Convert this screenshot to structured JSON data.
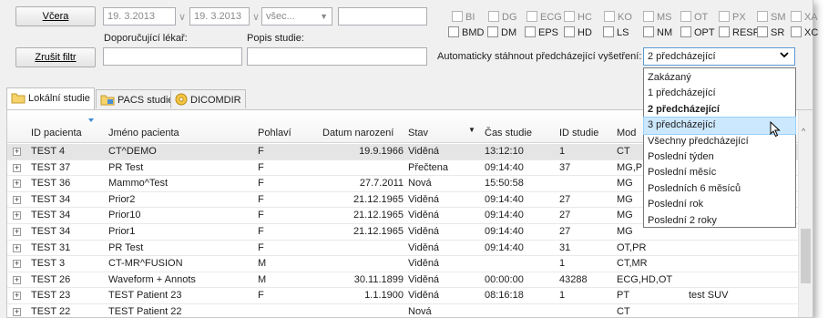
{
  "filters": {
    "yesterday_button": "Včera",
    "date_from": "19. 3.2013",
    "date_to": "19. 3.2013",
    "all_select": "všec...",
    "clear_filter_button": "Zrušit filtr",
    "referring_physician_label": "Doporučující lékař:",
    "referring_physician_value": "",
    "study_description_label": "Popis studie:",
    "study_description_value": "",
    "search_value": ""
  },
  "modalities_row1": [
    "BI",
    "DG",
    "ECG",
    "HC",
    "KO",
    "MS",
    "OT",
    "PX",
    "SM",
    "XA"
  ],
  "modalities_row2": [
    "BMD",
    "DM",
    "EPS",
    "HD",
    "LS",
    "NM",
    "OPT",
    "RESP",
    "SR",
    "XC"
  ],
  "auto_download": {
    "label": "Automaticky stáhnout předcházející vyšetření:",
    "selected": "2 předcházející",
    "options": [
      "Zakázaný",
      "1 předcházející",
      "2 předcházející",
      "3 předcházející",
      "Všechny předcházející",
      "Poslední týden",
      "Poslední měsíc",
      "Posledních 6 měsíců",
      "Poslední rok",
      "Poslední 2 roky"
    ],
    "selected_index": 2,
    "hover_index": 3
  },
  "tabs": [
    "Lokální studie",
    "PACS studie",
    "DICOMDIR"
  ],
  "columns": [
    "ID pacienta",
    "Jméno pacienta",
    "Pohlaví",
    "Datum narození",
    "Stav",
    "Čas studie",
    "ID studie",
    "Mod"
  ],
  "rows": [
    [
      "TEST 4",
      "CT^DEMO",
      "F",
      "19.9.1966",
      "Viděná",
      "13:12:10",
      "1",
      "CT",
      ""
    ],
    [
      "TEST 37",
      "PR Test",
      "F",
      "",
      "Přečtena",
      "09:14:40",
      "37",
      "MG,PR",
      ""
    ],
    [
      "TEST 36",
      "Mammo^Test",
      "F",
      "27.7.2011",
      "Nová",
      "15:50:58",
      "",
      "MG",
      ""
    ],
    [
      "TEST 34",
      "Prior2",
      "F",
      "21.12.1965",
      "Viděná",
      "09:14:40",
      "27",
      "MG",
      ""
    ],
    [
      "TEST 34",
      "Prior10",
      "F",
      "21.12.1965",
      "Viděná",
      "09:14:40",
      "27",
      "MG",
      ""
    ],
    [
      "TEST 34",
      "Prior1",
      "F",
      "21.12.1965",
      "Viděná",
      "09:14:40",
      "27",
      "MG",
      ""
    ],
    [
      "TEST 31",
      "PR Test",
      "F",
      "",
      "Viděná",
      "09:14:40",
      "31",
      "OT,PR",
      ""
    ],
    [
      "TEST 3",
      "CT-MR^FUSION",
      "M",
      "",
      "Viděná",
      "",
      "1",
      "CT,MR",
      ""
    ],
    [
      "TEST 26",
      "Waveform + Annots",
      "M",
      "30.11.1899",
      "Viděná",
      "00:00:00",
      "43288",
      "ECG,HD,OT",
      ""
    ],
    [
      "TEST 23",
      "TEST Patient 23",
      "F",
      "1.1.1900",
      "Viděná",
      "08:16:18",
      "1",
      "PT",
      "test SUV"
    ],
    [
      "TEST 22",
      "TEST Patient 22",
      "",
      "",
      "Nová",
      "",
      "",
      "CT",
      ""
    ]
  ]
}
